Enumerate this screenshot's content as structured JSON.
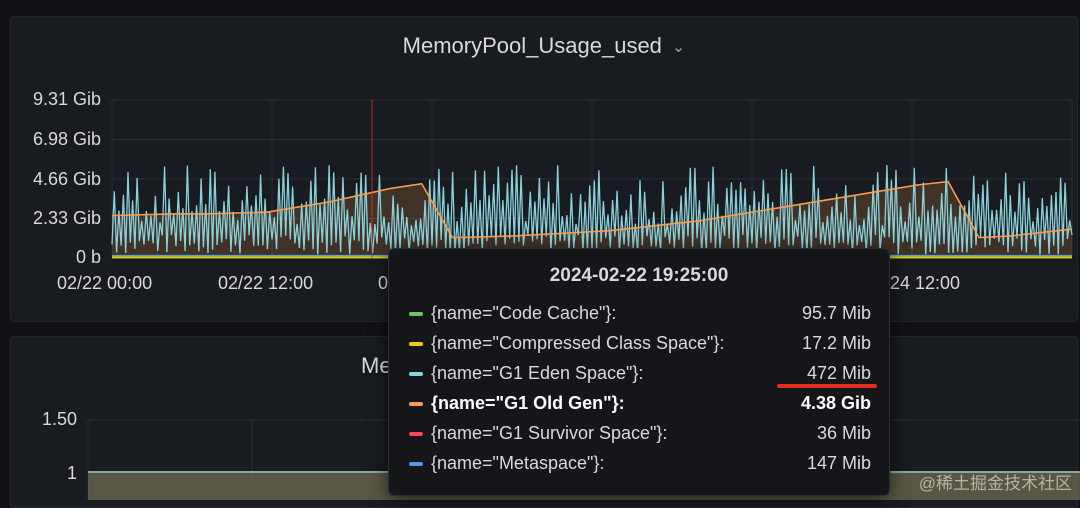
{
  "top_panel": {
    "title": "MemoryPool_Usage_used",
    "chevron": "chevron-down-icon"
  },
  "bottom_panel": {
    "title_partial": "Me",
    "y_ticks": [
      "1.50",
      "1"
    ]
  },
  "tooltip": {
    "time": "2024-02-22 19:25:00",
    "rows": [
      {
        "name": "{name=\"Code Cache\"}:",
        "value": "95.7 Mib",
        "color": "#73bf69"
      },
      {
        "name": "{name=\"Compressed Class Space\"}:",
        "value": "17.2 Mib",
        "color": "#f2cc0c"
      },
      {
        "name": "{name=\"G1 Eden Space\"}:",
        "value": "472 Mib",
        "color": "#8ad1dc"
      },
      {
        "name": "{name=\"G1 Old Gen\"}:",
        "value": "4.38 Gib",
        "color": "#ff9a4d"
      },
      {
        "name": "{name=\"G1 Survivor Space\"}:",
        "value": "36 Mib",
        "color": "#f2495c"
      },
      {
        "name": "{name=\"Metaspace\"}:",
        "value": "147 Mib",
        "color": "#5794f2"
      }
    ]
  },
  "watermark": "@稀土掘金技术社区",
  "chart_data": {
    "type": "line",
    "title": "MemoryPool_Usage_used",
    "y_ticks": [
      "0 b",
      "2.33 Gib",
      "4.66 Gib",
      "6.98 Gib",
      "9.31 Gib"
    ],
    "x_ticks": [
      "02/22 00:00",
      "02/22 12:00",
      "0",
      "24 12:00"
    ],
    "ylim_gib": [
      0,
      9.31
    ],
    "cursor_time": "2024-02-22 19:25:00",
    "grid": true,
    "series": [
      {
        "name": "{name=\"G1 Old Gen\"}",
        "color": "#ff9a4d",
        "values_gib": [
          2.5,
          2.55,
          2.6,
          2.6,
          2.65,
          2.7,
          3.0,
          3.3,
          3.7,
          4.1,
          4.38,
          1.2,
          1.25,
          1.3,
          1.4,
          1.5,
          1.6,
          1.8,
          2.0,
          2.2,
          2.5,
          2.8,
          3.1,
          3.4,
          3.7,
          4.0,
          4.3,
          4.5,
          1.2,
          1.3,
          1.5,
          1.7
        ]
      },
      {
        "name": "{name=\"G1 Eden Space\"}",
        "color": "#8ad1dc",
        "values_gib": [
          0.2,
          5.5
        ]
      },
      {
        "name": "{name=\"Metaspace\"}",
        "color": "#5794f2",
        "values_gib": [
          0.14,
          0.14
        ]
      },
      {
        "name": "{name=\"G1 Survivor Space\"}",
        "color": "#f2495c",
        "values_gib": [
          0.04,
          0.04
        ]
      },
      {
        "name": "{name=\"Code Cache\"}",
        "color": "#73bf69",
        "values_gib": [
          0.09,
          0.09
        ]
      },
      {
        "name": "{name=\"Compressed Class Space\"}",
        "color": "#f2cc0c",
        "values_gib": [
          0.02,
          0.02
        ]
      }
    ]
  }
}
